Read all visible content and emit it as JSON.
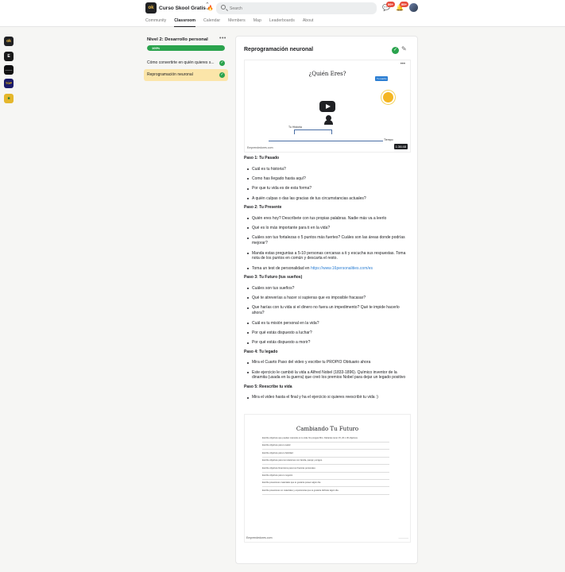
{
  "header": {
    "logo_text": "ok",
    "group_title": "Curso Skool Gratis 🔥",
    "search_placeholder": "Search",
    "chat_badge": "99+",
    "notif_badge": "99+"
  },
  "nav": [
    "Community",
    "Classroom",
    "Calendar",
    "Members",
    "Map",
    "Leaderboards",
    "About"
  ],
  "rail": [
    {
      "label": "ok",
      "bg": "#202124",
      "fg": "#f3c046"
    },
    {
      "label": "E",
      "bg": "#1a1a1a",
      "fg": "#ffffff"
    },
    {
      "label": "———",
      "bg": "#111111",
      "fg": "#ffffff"
    },
    {
      "label": "TOP",
      "bg": "#1b1b6a",
      "fg": "#ffcc00"
    },
    {
      "label": "■",
      "bg": "#e5b72c",
      "fg": "#2d7f3a"
    }
  ],
  "sidebar": {
    "level_title": "Nivel 2: Desarrollo personal",
    "progress_label": "100%",
    "progress_value": 100,
    "lessons": [
      {
        "label": "Cómo convertirte en quién quieres s..."
      },
      {
        "label": "Reprogramación neuronal"
      }
    ]
  },
  "main": {
    "title": "Reprogramación neuronal",
    "video": {
      "title": "¿Quién Eres?",
      "sun_label": "Tu sueño",
      "history_label": "Tu Historia",
      "time_label": "Tiempo",
      "watermark": "Emprendedores.com",
      "duration": "1:36:48"
    },
    "sections": [
      {
        "heading": "Paso 1: Tu Pasado",
        "items": [
          "Cuál es tu historia?",
          "Como has llegado hasta aquí?",
          "Por que tu vida es de esta forma?",
          "A quién culpas o das las gracias de tus circumstancias actuales?"
        ]
      },
      {
        "heading": "Paso 2: Tu Presente",
        "items": [
          "Quién eres hoy? Descríbete con tus propias palabras. Nadie más va a leerlo",
          "Qué es lo más importante para ti en la vida?",
          "Cuáles son tus fortalezas o 5 puntos más fuertes? Cuáles son las áreas donde podrías mejorar?",
          "Manda estas preguntas a 5-10 personas cercanas a ti y escucha sus respuestas. Toma nota de los puntos en común y descarta el resto."
        ],
        "link_item_text": "Toma un test de personalidad en ",
        "link": "https://www.16personalities.com/es"
      },
      {
        "heading": "Paso 3: Tu Futuro (tus sueños)",
        "items": [
          "Cuáles son tus sueños?",
          "Qué te atreverías a hacer si supieras que es imposible fracasar?",
          "Que harías con tu vida si el dinero no fuera un impedimento? Qué te impide hacerlo ahora?",
          "Cuál es tu misión personal en la vida?",
          "Por qué estás dispuesto a luchar?",
          "Por qué estás dispuesto a morir?"
        ]
      },
      {
        "heading": "Paso 4: Tu legado",
        "items": [
          "Mira el Cuarto Paso del video y escribe tu PROPIO Obituario ahora",
          "Este ejercicio le cambió la vida a Alfred Nobel (1833-1896). Químico inventor de la dinamita (usada en la guerra) que creó los premios Nobel para dejar un legado positivo"
        ]
      },
      {
        "heading": "Paso 5: Reescribe tu vida",
        "items": [
          "Mira el video hasta el final y ha el ejercicio si quieres reescribir tu vida :)"
        ]
      }
    ],
    "document": {
      "title": "Cambiando Tu Futuro",
      "lines": [
        "Escribe objetivos que puedan marcarte en tu vida. No pongas filtro. Debarías tener 15, 20 o 30 objetivos.",
        "Escribe objetivos para tu salud",
        "Escribe objetivos para tu felicidad",
        "Escribe objetivos para tus relaciones con familia, pareja y amigos.",
        "Escribe objetivos financieros para tus finanzas personales",
        "Escribe objetivos para tu negocio",
        "Escribe posesiones materiales que te gustaría poseer algún día.",
        "Escribe posesiones no materiales y experiencias que te gustaría disfrutar algún día."
      ],
      "watermark": "Emprendedores.com"
    }
  }
}
